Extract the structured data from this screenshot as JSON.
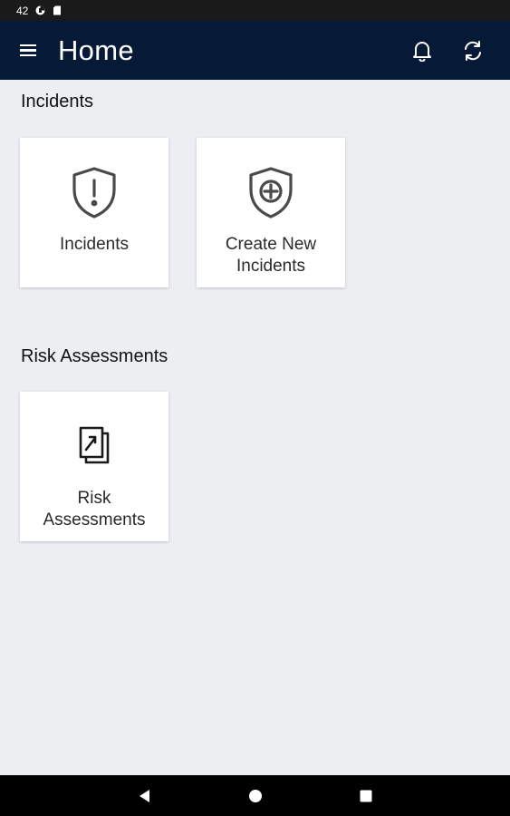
{
  "status_bar": {
    "time": "42",
    "icons": [
      "data-saver-icon",
      "sim-card-icon"
    ]
  },
  "app_bar": {
    "title": "Home",
    "menu_icon": "hamburger-menu-icon",
    "actions": [
      "bell-icon",
      "refresh-icon"
    ],
    "background": "#061a37"
  },
  "sections": {
    "incidents": {
      "title": "Incidents",
      "tiles": [
        {
          "label": "Incidents",
          "icon": "shield-alert-icon"
        },
        {
          "label": "Create New\nIncidents",
          "icon": "shield-plus-icon"
        }
      ]
    },
    "risk": {
      "title": "Risk Assessments",
      "tiles": [
        {
          "label": "Risk\nAssessments",
          "icon": "documents-arrow-icon"
        }
      ]
    }
  },
  "nav_bar": {
    "buttons": [
      "back-icon",
      "home-icon",
      "recents-icon"
    ]
  },
  "colors": {
    "page_background": "#eceef2",
    "tile_background": "#ffffff",
    "icon_color": "#4a4a4a"
  }
}
